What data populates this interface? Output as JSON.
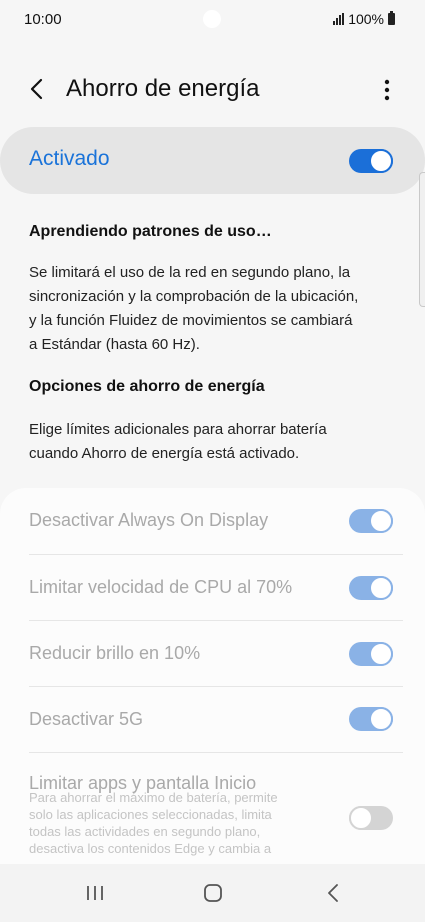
{
  "status_bar": {
    "time": "10:00",
    "battery": "100%",
    "icons": [
      "signal-icon",
      "battery-icon"
    ]
  },
  "header": {
    "title": "Ahorro de energía",
    "back_icon": "chevron-left-icon",
    "more_icon": "more-vert-icon"
  },
  "master": {
    "label": "Activado",
    "state": "on",
    "accent": "#1a73d9"
  },
  "learning": {
    "heading": "Aprendiendo patrones de uso…",
    "lines": [
      "Se limitará el uso de la red en segundo plano, la",
      "sincronización y la comprobación de la ubicación,",
      "y la función Fluidez de movimientos se cambiará",
      "a Estándar (hasta 60 Hz)."
    ]
  },
  "options_section": {
    "heading": "Opciones de ahorro de energía",
    "lines": [
      "Elige límites adicionales para ahorrar batería",
      "cuando Ahorro de energía está activado."
    ]
  },
  "options": [
    {
      "label": "Desactivar Always On Display",
      "state": "on"
    },
    {
      "label": "Limitar velocidad de CPU al 70%",
      "state": "on"
    },
    {
      "label": "Reducir brillo en 10%",
      "state": "on"
    },
    {
      "label": "Desactivar 5G",
      "state": "on"
    },
    {
      "label": "Limitar apps y pantalla Inicio",
      "state": "off",
      "description_lines": [
        "Para ahorrar el máximo de batería, permite",
        "solo las aplicaciones seleccionadas, limita",
        "todas las actividades en segundo plano,",
        "desactiva los contenidos Edge y cambia a"
      ]
    }
  ],
  "nav_bar": {
    "icons": [
      "recent-apps-icon",
      "home-icon",
      "back-nav-icon"
    ]
  }
}
